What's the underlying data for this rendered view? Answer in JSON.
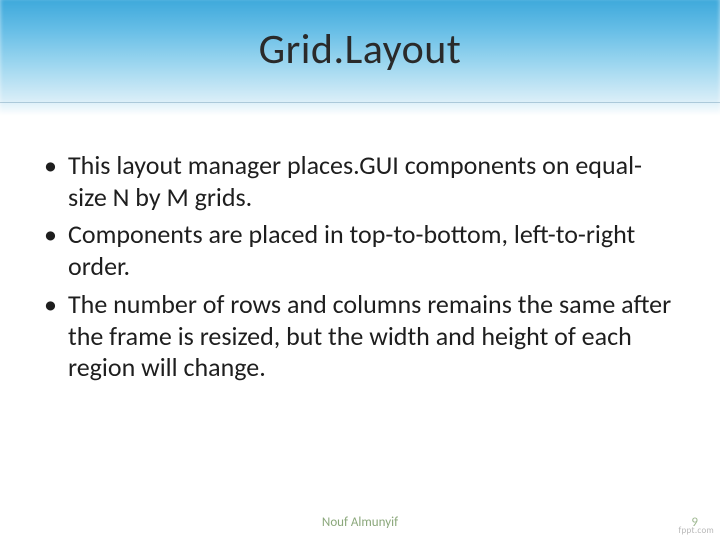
{
  "title": "Grid.Layout",
  "bullets": [
    "This layout manager places.GUI components on equal-size N by M grids.",
    "Components are placed in top-to-bottom, left-to-right order.",
    "The number of rows and columns remains the same after the frame is resized, but the width and height of each region will change."
  ],
  "footer": {
    "author": "Nouf Almunyif",
    "page": "9",
    "watermark": "fppt.com"
  }
}
